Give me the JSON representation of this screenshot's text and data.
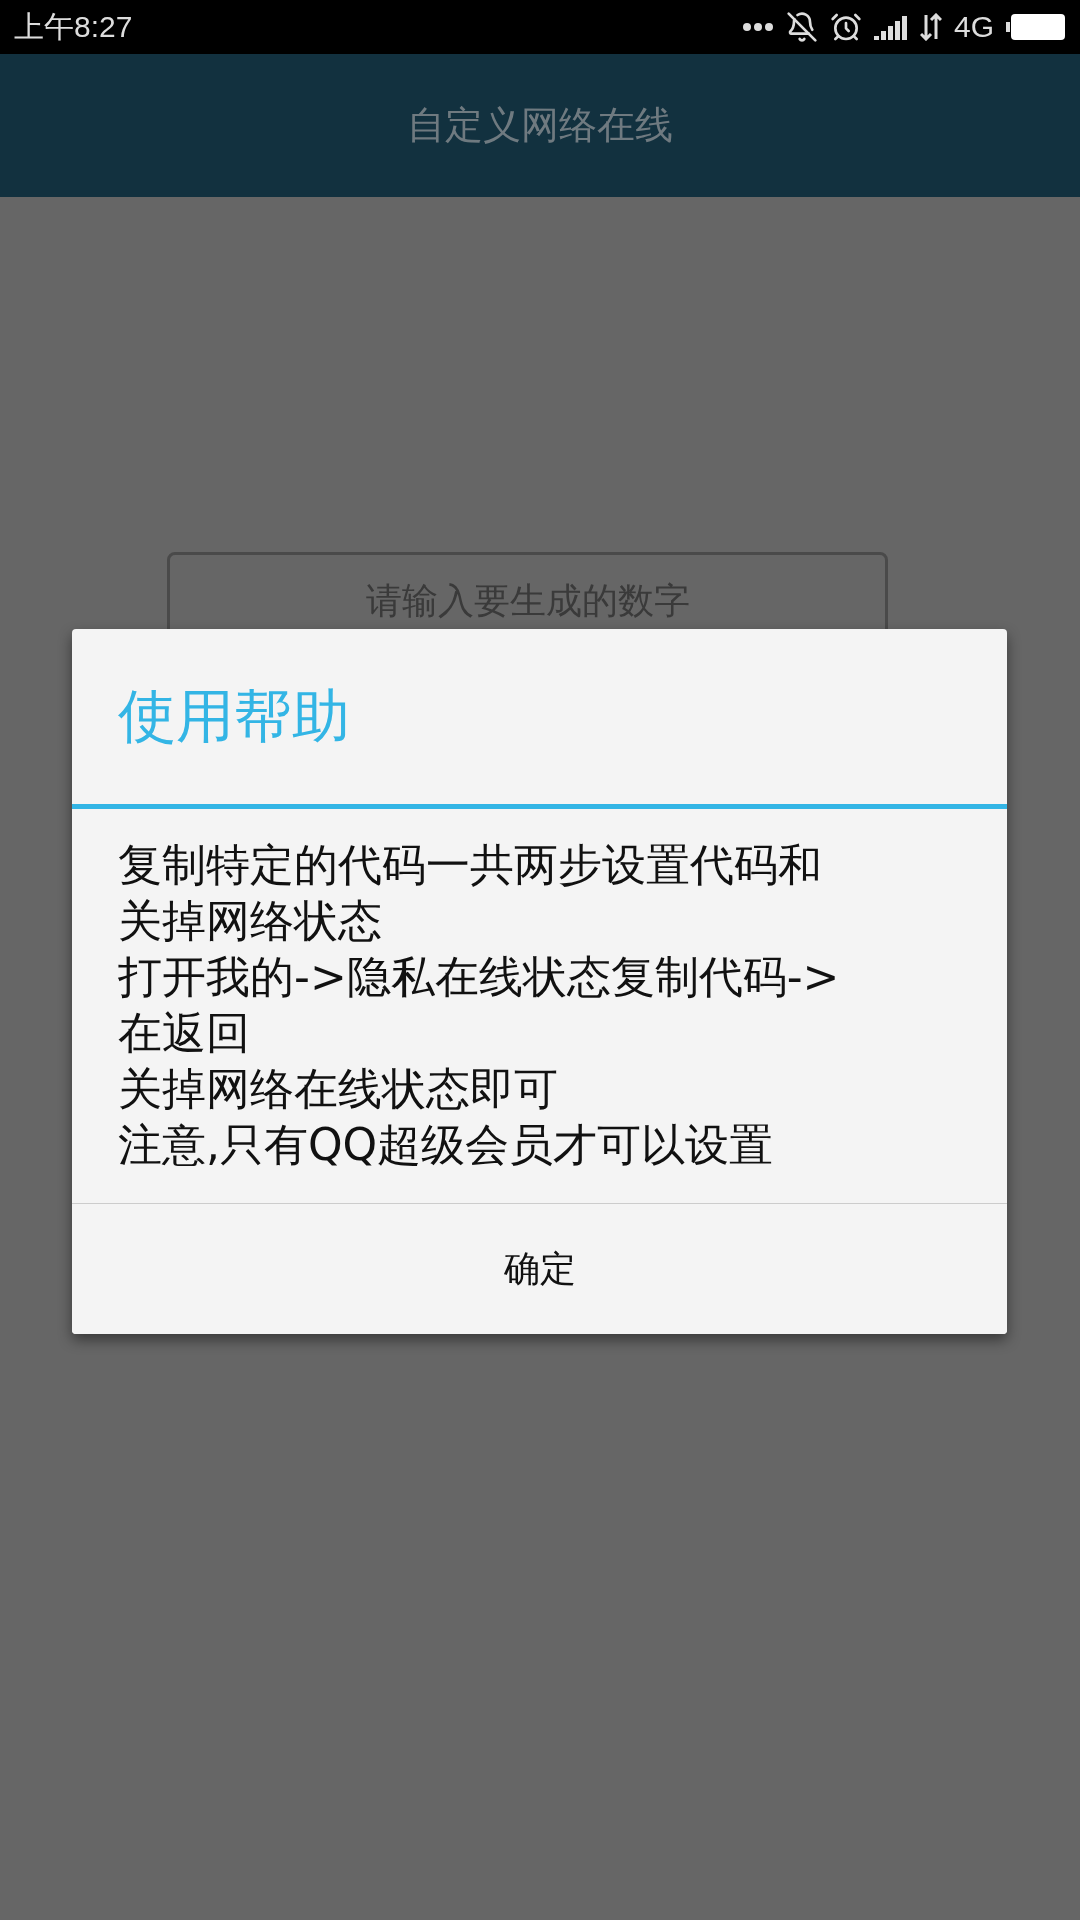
{
  "status_bar": {
    "time": "上午8:27",
    "network": "4G"
  },
  "app_bar": {
    "title": "自定义网络在线"
  },
  "input": {
    "placeholder": "请输入要生成的数字"
  },
  "dialog": {
    "title": "使用帮助",
    "lines": [
      "复制特定的代码一共两步设置代码和",
      "关掉网络状态",
      "打开我的->隐私在线状态复制代码->",
      "在返回",
      "关掉网络在线状态即可",
      "注意,只有QQ超级会员才可以设置"
    ],
    "buttons": [
      "确定"
    ]
  }
}
